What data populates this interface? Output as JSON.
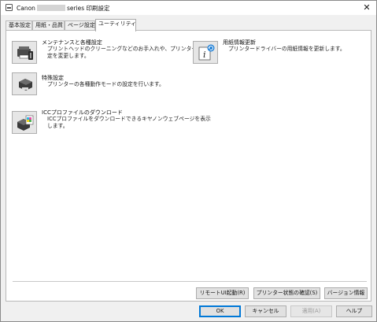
{
  "window": {
    "title_prefix": "Canon",
    "title_suffix": "series 印刷設定",
    "close_glyph": "✕"
  },
  "tabs": [
    {
      "label": "基本設定"
    },
    {
      "label": "用紙・品質"
    },
    {
      "label": "ページ設定"
    },
    {
      "label": "ユーティリティ"
    }
  ],
  "items": {
    "maintenance": {
      "title": "メンテナンスと各種設定",
      "desc_line1": "プリントヘッドのクリーニングなどのお手入れや、プリンターの設",
      "desc_line2": "定を変更します。",
      "icon": "printer-maintenance-icon"
    },
    "media_update": {
      "title": "用紙情報更新",
      "desc_line1": "プリンタードライバーの用紙情報を更新します。",
      "icon": "info-update-icon"
    },
    "special": {
      "title": "特殊設定",
      "desc_line1": "プリンターの各種動作モードの設定を行います。",
      "icon": "printer-special-settings-icon"
    },
    "icc": {
      "title": "ICCプロファイルのダウンロード",
      "desc_line1": "ICCプロファイルをダウンロードできるキヤノンウェブページを表示",
      "desc_line2": "します。",
      "icon": "icc-download-icon"
    }
  },
  "lower_buttons": {
    "remote_ui": "リモートUI起動(R)",
    "printer_status": "プリンター状態の確認(S)",
    "version": "バージョン情報"
  },
  "dialog_buttons": {
    "ok": "OK",
    "cancel": "キャンセル",
    "apply": "適用(A)",
    "help": "ヘルプ"
  },
  "colors": {
    "accent": "#0078d7",
    "window_bg": "#f0f0f0",
    "panel_bg": "#ffffff"
  }
}
